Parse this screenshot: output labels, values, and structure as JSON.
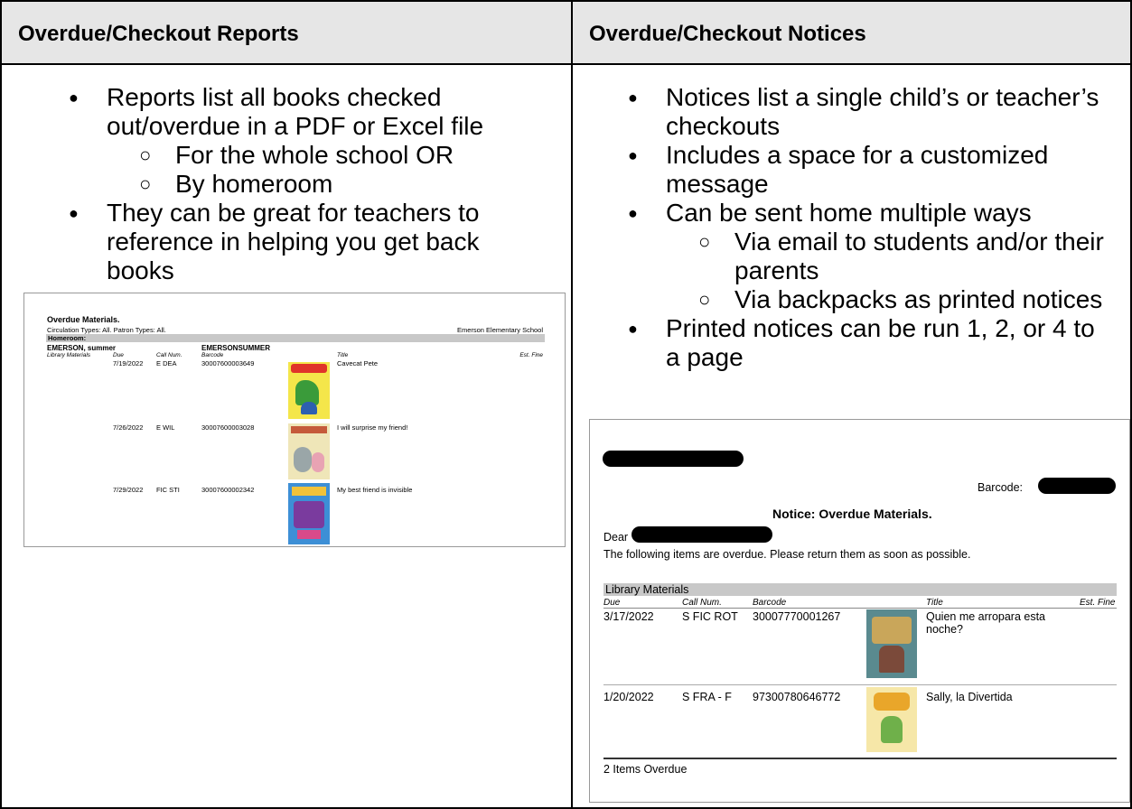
{
  "left": {
    "heading": "Overdue/Checkout Reports",
    "bullets": [
      "Reports list all books checked out/overdue in a PDF or Excel file",
      "They can be great for teachers to reference in helping you get back books"
    ],
    "sub_bullets": [
      "For the whole school OR",
      "By homeroom"
    ],
    "report": {
      "title": "Overdue Materials.",
      "filters": "Circulation Types: All.  Patron Types: All.",
      "school": "Emerson Elementary School",
      "band": "Homeroom:",
      "patron": "EMERSON, summer",
      "patron_id": "EMERSONSUMMER",
      "headers": {
        "type": "Library Materials",
        "due": "Due",
        "call": "Call Num.",
        "barcode": "Barcode",
        "title": "Title",
        "fine": "Est. Fine"
      },
      "rows": [
        {
          "due": "7/19/2022",
          "call": "E DEA",
          "barcode": "30007600003649",
          "title": "Cavecat Pete"
        },
        {
          "due": "7/26/2022",
          "call": "E WIL",
          "barcode": "30007600003028",
          "title": "I will surprise my friend!"
        },
        {
          "due": "7/29/2022",
          "call": "FIC STI",
          "barcode": "30007600002342",
          "title": "My best friend is invisible"
        }
      ]
    }
  },
  "right": {
    "heading": "Overdue/Checkout Notices",
    "bullet1": "Notices list a single child’s or teacher’s checkouts",
    "bullet2": "Includes a space for a customized message",
    "bullet3": "Can be sent home multiple ways",
    "sub_bullets": [
      "Via email to students and/or their parents",
      "Via backpacks as printed notices"
    ],
    "bullet4": "Printed notices can be run 1, 2, or 4 to a page",
    "notice": {
      "barcode_label": "Barcode:",
      "title": "Notice: Overdue Materials.",
      "dear": "Dear",
      "message": "The following items are overdue. Please return them as soon as possible.",
      "band": "Library Materials",
      "headers": {
        "due": "Due",
        "call": "Call Num.",
        "barcode": "Barcode",
        "title": "Title",
        "fine": "Est. Fine"
      },
      "rows": [
        {
          "due": "3/17/2022",
          "call": "S FIC ROT",
          "barcode": "30007770001267",
          "title": "Quien me arropara esta noche?"
        },
        {
          "due": "1/20/2022",
          "call": "S FRA - F",
          "barcode": "97300780646772",
          "title": "Sally, la Divertida"
        }
      ],
      "footer": "2 Items Overdue"
    }
  },
  "colors": {
    "header_bg": "#e6e6e6",
    "band": "#c8c8c8",
    "border": "#000000"
  }
}
